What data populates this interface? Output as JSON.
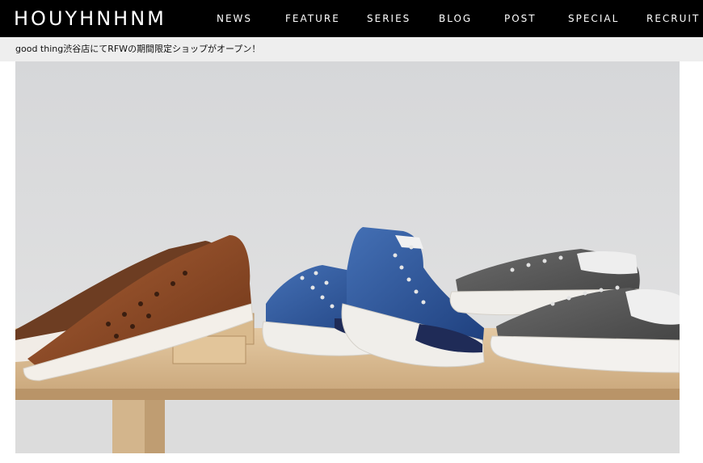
{
  "header": {
    "logo_text": "HOUYHNHNM",
    "nav": [
      {
        "label": "NEWS"
      },
      {
        "label": "FEATURE"
      },
      {
        "label": "SERIES"
      },
      {
        "label": "BLOG"
      },
      {
        "label": "POST"
      },
      {
        "label": "SPECIAL"
      },
      {
        "label": "RECRUIT"
      }
    ]
  },
  "ticker": {
    "headline": "good thing渋谷店にてRFWの期間限定ショップがオープン！"
  },
  "colors": {
    "header_bg": "#000000",
    "ticker_bg": "#eeeeee"
  }
}
